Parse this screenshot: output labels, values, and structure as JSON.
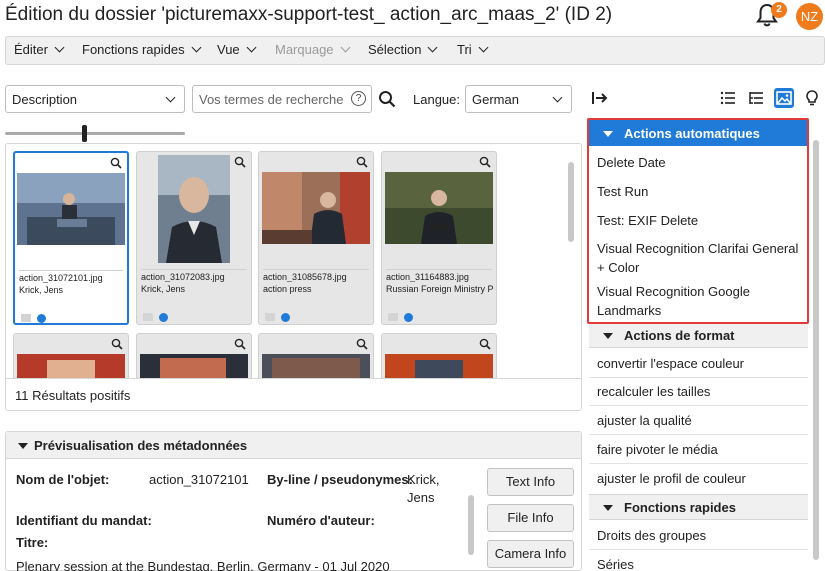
{
  "header": {
    "title": "Édition du dossier 'picturemaxx-support-test_ action_arc_maas_2' (ID 2)",
    "notification_count": "2",
    "user_initials": "NZ",
    "accent_color": "#f07b1d"
  },
  "menubar": {
    "items": [
      "Éditer",
      "Fonctions rapides",
      "Vue",
      "Marquage",
      "Sélection",
      "Tri"
    ]
  },
  "search": {
    "field_select": "Description",
    "placeholder": "Vos termes de recherche",
    "help_icon": "question-circle-icon",
    "language_label": "Langue:",
    "language_value": "German"
  },
  "results": {
    "cards": [
      {
        "filename": "action_31072101.jpg",
        "author": "Krick, Jens"
      },
      {
        "filename": "action_31072083.jpg",
        "author": "Krick, Jens"
      },
      {
        "filename": "action_31085678.jpg",
        "author": "action press"
      },
      {
        "filename": "action_31164883.jpg",
        "author": "Russian Foreign Ministry P"
      }
    ],
    "count_text": "11 Résultats positifs"
  },
  "metadata": {
    "title": "Prévisualisation des métadonnées",
    "object_name_label": "Nom de l'objet:",
    "object_name_value": "action_31072101",
    "byline_label": "By-line / pseudonymes:",
    "byline_value_1": "Krick,",
    "byline_value_2": "Jens",
    "mandate_label": "Identifiant du mandat:",
    "author_number_label": "Numéro d'auteur:",
    "title_label": "Titre:",
    "title_value": "Plenary session at the Bundestag, Berlin, Germany - 01 Jul 2020",
    "buttons": [
      "Text Info",
      "File Info",
      "Camera Info"
    ]
  },
  "actions_panel": {
    "sections": [
      {
        "label": "Actions automatiques",
        "items": [
          "Delete Date",
          "Test Run",
          "Test: EXIF Delete",
          "Visual Recognition Clarifai General + Color",
          "Visual Recognition Google Landmarks"
        ]
      },
      {
        "label": "Actions de format",
        "items": [
          "convertir l'espace couleur",
          "recalculer les tailles",
          "ajuster la qualité",
          "faire pivoter le média",
          "ajuster le profil de couleur"
        ]
      },
      {
        "label": "Fonctions rapides",
        "items": [
          "Droits des groupes",
          "Séries"
        ]
      }
    ]
  }
}
